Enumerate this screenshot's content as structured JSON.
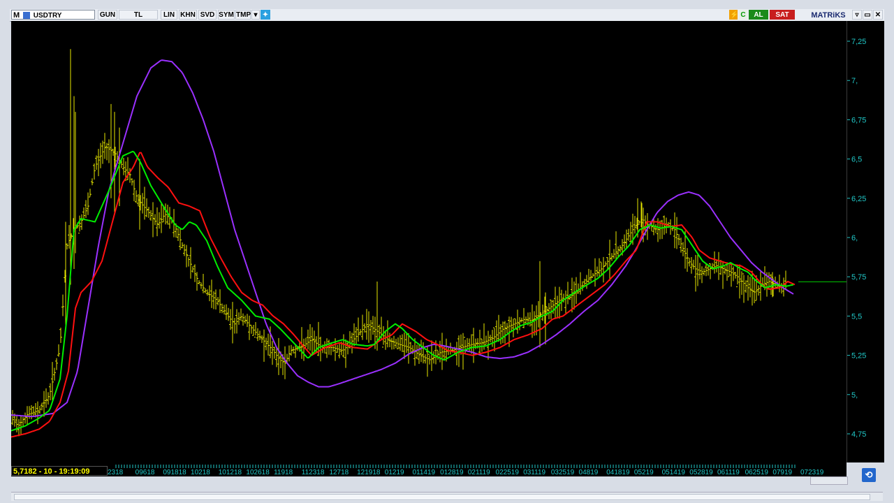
{
  "toolbar": {
    "logo": "M",
    "symbol": "USDTRY",
    "buttons": [
      "GUN",
      "TL",
      "LIN",
      "KHN",
      "SVD",
      "SYM",
      "TMP"
    ],
    "al_label": "AL",
    "sat_label": "SAT",
    "brand": "MATRiKS"
  },
  "status": {
    "readout": "5,7182 - 10 - 19:19:09"
  },
  "colors": {
    "price_bars": "#e8e800",
    "ma_fast": "#00ee00",
    "ma_mid": "#ff1010",
    "ma_slow": "#9a30ff",
    "axis_text": "#20c8c8",
    "last_price_line": "#00cc00",
    "background": "#000000"
  },
  "chart_data": {
    "type": "line",
    "series_kind": "ohlc-bars-with-moving-averages",
    "ylim": [
      4.6,
      7.35
    ],
    "y_ticks": [
      "7,25",
      "7,",
      "6,75",
      "6,5",
      "6,25",
      "6,",
      "5,75",
      "5,5",
      "5,25",
      "5,",
      "4,75"
    ],
    "y_tick_values": [
      7.25,
      7.0,
      6.75,
      6.5,
      6.25,
      6.0,
      5.75,
      5.5,
      5.25,
      5.0,
      4.75
    ],
    "x_labels": [
      "2318",
      "09618",
      "091818",
      "10218",
      "101218",
      "102618",
      "11918",
      "112318",
      "12718",
      "121918",
      "01219",
      "011419",
      "012819",
      "021119",
      "022519",
      "031119",
      "032519",
      "04819",
      "041819",
      "05219",
      "051419",
      "052819",
      "061119",
      "062519",
      "07919",
      "072319"
    ],
    "last_price": 5.7182,
    "close_anchors": [
      [
        0,
        4.85
      ],
      [
        10,
        4.8
      ],
      [
        22,
        4.87
      ],
      [
        40,
        4.9
      ],
      [
        55,
        5.0
      ],
      [
        70,
        5.3
      ],
      [
        80,
        5.95
      ],
      [
        90,
        6.05
      ],
      [
        100,
        6.1
      ],
      [
        110,
        6.2
      ],
      [
        120,
        6.45
      ],
      [
        135,
        6.58
      ],
      [
        150,
        6.53
      ],
      [
        160,
        6.45
      ],
      [
        170,
        6.4
      ],
      [
        180,
        6.25
      ],
      [
        195,
        6.17
      ],
      [
        210,
        6.08
      ],
      [
        220,
        6.15
      ],
      [
        232,
        6.1
      ],
      [
        245,
        5.95
      ],
      [
        255,
        5.85
      ],
      [
        268,
        5.72
      ],
      [
        280,
        5.65
      ],
      [
        295,
        5.6
      ],
      [
        310,
        5.5
      ],
      [
        320,
        5.45
      ],
      [
        330,
        5.5
      ],
      [
        345,
        5.42
      ],
      [
        360,
        5.35
      ],
      [
        375,
        5.28
      ],
      [
        385,
        5.22
      ],
      [
        392,
        5.2
      ],
      [
        400,
        5.28
      ],
      [
        415,
        5.3
      ],
      [
        430,
        5.35
      ],
      [
        445,
        5.3
      ],
      [
        460,
        5.3
      ],
      [
        475,
        5.28
      ],
      [
        490,
        5.35
      ],
      [
        510,
        5.45
      ],
      [
        525,
        5.4
      ],
      [
        540,
        5.35
      ],
      [
        555,
        5.32
      ],
      [
        570,
        5.3
      ],
      [
        585,
        5.25
      ],
      [
        600,
        5.22
      ],
      [
        615,
        5.27
      ],
      [
        630,
        5.28
      ],
      [
        645,
        5.3
      ],
      [
        660,
        5.32
      ],
      [
        675,
        5.33
      ],
      [
        690,
        5.36
      ],
      [
        705,
        5.42
      ],
      [
        720,
        5.45
      ],
      [
        735,
        5.48
      ],
      [
        745,
        5.47
      ],
      [
        755,
        5.5
      ],
      [
        770,
        5.55
      ],
      [
        785,
        5.6
      ],
      [
        800,
        5.62
      ],
      [
        815,
        5.68
      ],
      [
        830,
        5.75
      ],
      [
        845,
        5.8
      ],
      [
        860,
        5.88
      ],
      [
        875,
        5.95
      ],
      [
        890,
        6.05
      ],
      [
        903,
        6.12
      ],
      [
        912,
        6.08
      ],
      [
        925,
        6.05
      ],
      [
        940,
        6.08
      ],
      [
        950,
        6.05
      ],
      [
        960,
        5.95
      ],
      [
        970,
        5.85
      ],
      [
        980,
        5.8
      ],
      [
        990,
        5.78
      ],
      [
        1000,
        5.8
      ],
      [
        1010,
        5.82
      ],
      [
        1020,
        5.8
      ],
      [
        1030,
        5.78
      ],
      [
        1040,
        5.75
      ],
      [
        1055,
        5.68
      ],
      [
        1065,
        5.65
      ],
      [
        1075,
        5.7
      ],
      [
        1085,
        5.72
      ],
      [
        1095,
        5.7
      ],
      [
        1104,
        5.69
      ],
      [
        1110,
        5.72
      ]
    ],
    "ma_fast_anchors": [
      [
        0,
        4.77
      ],
      [
        20,
        4.8
      ],
      [
        40,
        4.85
      ],
      [
        55,
        4.9
      ],
      [
        70,
        5.1
      ],
      [
        80,
        5.5
      ],
      [
        90,
        6.05
      ],
      [
        100,
        6.12
      ],
      [
        120,
        6.1
      ],
      [
        140,
        6.3
      ],
      [
        160,
        6.52
      ],
      [
        175,
        6.55
      ],
      [
        185,
        6.48
      ],
      [
        200,
        6.33
      ],
      [
        215,
        6.22
      ],
      [
        235,
        6.08
      ],
      [
        245,
        6.05
      ],
      [
        255,
        6.1
      ],
      [
        265,
        6.08
      ],
      [
        280,
        5.98
      ],
      [
        295,
        5.82
      ],
      [
        310,
        5.68
      ],
      [
        330,
        5.6
      ],
      [
        350,
        5.5
      ],
      [
        370,
        5.48
      ],
      [
        385,
        5.42
      ],
      [
        400,
        5.35
      ],
      [
        415,
        5.28
      ],
      [
        425,
        5.23
      ],
      [
        440,
        5.3
      ],
      [
        460,
        5.33
      ],
      [
        475,
        5.35
      ],
      [
        490,
        5.32
      ],
      [
        510,
        5.31
      ],
      [
        520,
        5.32
      ],
      [
        535,
        5.4
      ],
      [
        550,
        5.45
      ],
      [
        560,
        5.42
      ],
      [
        575,
        5.35
      ],
      [
        590,
        5.3
      ],
      [
        605,
        5.25
      ],
      [
        620,
        5.22
      ],
      [
        640,
        5.27
      ],
      [
        660,
        5.3
      ],
      [
        680,
        5.31
      ],
      [
        700,
        5.35
      ],
      [
        715,
        5.4
      ],
      [
        730,
        5.44
      ],
      [
        745,
        5.46
      ],
      [
        760,
        5.5
      ],
      [
        775,
        5.53
      ],
      [
        790,
        5.6
      ],
      [
        810,
        5.66
      ],
      [
        825,
        5.7
      ],
      [
        840,
        5.74
      ],
      [
        855,
        5.8
      ],
      [
        870,
        5.88
      ],
      [
        885,
        5.95
      ],
      [
        900,
        6.05
      ],
      [
        915,
        6.08
      ],
      [
        930,
        6.06
      ],
      [
        945,
        6.07
      ],
      [
        960,
        6.05
      ],
      [
        975,
        5.95
      ],
      [
        990,
        5.85
      ],
      [
        1005,
        5.8
      ],
      [
        1020,
        5.82
      ],
      [
        1030,
        5.84
      ],
      [
        1045,
        5.8
      ],
      [
        1055,
        5.78
      ],
      [
        1065,
        5.73
      ],
      [
        1080,
        5.68
      ],
      [
        1095,
        5.7
      ],
      [
        1110,
        5.69
      ],
      [
        1120,
        5.7
      ]
    ],
    "ma_mid_anchors": [
      [
        0,
        4.73
      ],
      [
        20,
        4.75
      ],
      [
        40,
        4.78
      ],
      [
        55,
        4.83
      ],
      [
        70,
        4.95
      ],
      [
        82,
        5.15
      ],
      [
        92,
        5.55
      ],
      [
        100,
        5.65
      ],
      [
        115,
        5.72
      ],
      [
        130,
        5.85
      ],
      [
        145,
        6.1
      ],
      [
        160,
        6.35
      ],
      [
        175,
        6.45
      ],
      [
        185,
        6.55
      ],
      [
        195,
        6.45
      ],
      [
        210,
        6.38
      ],
      [
        225,
        6.32
      ],
      [
        240,
        6.22
      ],
      [
        255,
        6.2
      ],
      [
        270,
        6.17
      ],
      [
        285,
        6.0
      ],
      [
        300,
        5.87
      ],
      [
        315,
        5.75
      ],
      [
        330,
        5.65
      ],
      [
        345,
        5.6
      ],
      [
        360,
        5.57
      ],
      [
        375,
        5.5
      ],
      [
        390,
        5.45
      ],
      [
        405,
        5.38
      ],
      [
        420,
        5.3
      ],
      [
        430,
        5.25
      ],
      [
        450,
        5.3
      ],
      [
        470,
        5.33
      ],
      [
        490,
        5.3
      ],
      [
        510,
        5.29
      ],
      [
        530,
        5.35
      ],
      [
        545,
        5.38
      ],
      [
        560,
        5.45
      ],
      [
        580,
        5.4
      ],
      [
        595,
        5.35
      ],
      [
        610,
        5.32
      ],
      [
        625,
        5.28
      ],
      [
        640,
        5.27
      ],
      [
        660,
        5.25
      ],
      [
        680,
        5.27
      ],
      [
        700,
        5.3
      ],
      [
        720,
        5.35
      ],
      [
        740,
        5.38
      ],
      [
        760,
        5.42
      ],
      [
        775,
        5.48
      ],
      [
        790,
        5.5
      ],
      [
        805,
        5.55
      ],
      [
        820,
        5.6
      ],
      [
        835,
        5.65
      ],
      [
        850,
        5.7
      ],
      [
        865,
        5.77
      ],
      [
        880,
        5.85
      ],
      [
        895,
        5.92
      ],
      [
        910,
        6.1
      ],
      [
        925,
        6.1
      ],
      [
        945,
        6.07
      ],
      [
        960,
        6.08
      ],
      [
        975,
        6.0
      ],
      [
        985,
        5.92
      ],
      [
        1000,
        5.87
      ],
      [
        1015,
        5.85
      ],
      [
        1030,
        5.83
      ],
      [
        1045,
        5.82
      ],
      [
        1060,
        5.78
      ],
      [
        1075,
        5.7
      ],
      [
        1085,
        5.67
      ],
      [
        1100,
        5.68
      ],
      [
        1112,
        5.72
      ],
      [
        1122,
        5.7
      ]
    ],
    "ma_slow_anchors": [
      [
        0,
        4.87
      ],
      [
        30,
        4.86
      ],
      [
        60,
        4.88
      ],
      [
        80,
        4.95
      ],
      [
        95,
        5.15
      ],
      [
        110,
        5.55
      ],
      [
        125,
        5.95
      ],
      [
        140,
        6.3
      ],
      [
        160,
        6.6
      ],
      [
        180,
        6.9
      ],
      [
        200,
        7.08
      ],
      [
        215,
        7.13
      ],
      [
        230,
        7.12
      ],
      [
        245,
        7.05
      ],
      [
        260,
        6.92
      ],
      [
        275,
        6.75
      ],
      [
        290,
        6.55
      ],
      [
        305,
        6.3
      ],
      [
        320,
        6.05
      ],
      [
        335,
        5.85
      ],
      [
        350,
        5.65
      ],
      [
        365,
        5.45
      ],
      [
        380,
        5.3
      ],
      [
        395,
        5.2
      ],
      [
        410,
        5.12
      ],
      [
        425,
        5.08
      ],
      [
        440,
        5.05
      ],
      [
        455,
        5.05
      ],
      [
        470,
        5.07
      ],
      [
        490,
        5.1
      ],
      [
        510,
        5.13
      ],
      [
        530,
        5.16
      ],
      [
        550,
        5.2
      ],
      [
        570,
        5.26
      ],
      [
        590,
        5.3
      ],
      [
        605,
        5.32
      ],
      [
        620,
        5.31
      ],
      [
        640,
        5.29
      ],
      [
        660,
        5.27
      ],
      [
        680,
        5.24
      ],
      [
        700,
        5.23
      ],
      [
        720,
        5.24
      ],
      [
        740,
        5.27
      ],
      [
        760,
        5.32
      ],
      [
        780,
        5.38
      ],
      [
        800,
        5.45
      ],
      [
        820,
        5.53
      ],
      [
        840,
        5.6
      ],
      [
        860,
        5.7
      ],
      [
        880,
        5.82
      ],
      [
        895,
        5.93
      ],
      [
        910,
        6.05
      ],
      [
        925,
        6.16
      ],
      [
        940,
        6.23
      ],
      [
        955,
        6.27
      ],
      [
        970,
        6.29
      ],
      [
        985,
        6.27
      ],
      [
        1000,
        6.2
      ],
      [
        1015,
        6.1
      ],
      [
        1030,
        6.0
      ],
      [
        1045,
        5.92
      ],
      [
        1060,
        5.84
      ],
      [
        1075,
        5.78
      ],
      [
        1090,
        5.73
      ],
      [
        1105,
        5.68
      ],
      [
        1120,
        5.64
      ]
    ],
    "spikes": [
      [
        85,
        7.2,
        5.7
      ],
      [
        90,
        6.9,
        5.8
      ],
      [
        92,
        6.8,
        5.9
      ],
      [
        78,
        6.1,
        5.4
      ],
      [
        143,
        6.85,
        6.25
      ],
      [
        148,
        6.8,
        6.15
      ],
      [
        155,
        6.7,
        6.2
      ],
      [
        184,
        6.5,
        6.05
      ],
      [
        524,
        5.72,
        5.28
      ],
      [
        757,
        5.85,
        5.3
      ],
      [
        765,
        5.65,
        5.32
      ],
      [
        897,
        6.25,
        6.0
      ],
      [
        903,
        6.22,
        6.02
      ],
      [
        1090,
        5.78,
        5.62
      ]
    ],
    "last_price_line_from_x": 1127
  }
}
